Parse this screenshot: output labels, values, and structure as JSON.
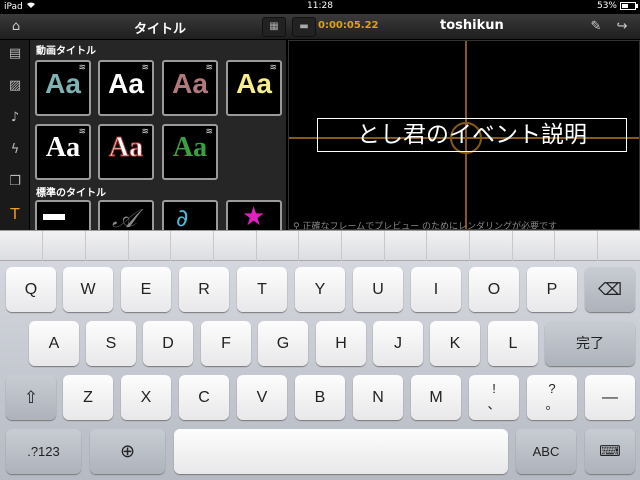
{
  "status": {
    "device": "iPad",
    "time": "11:28",
    "battery": "53%",
    "battery_fraction": 0.53
  },
  "toolbar": {
    "title": "タイトル",
    "timecode": "0:00:05.22",
    "project_name": "toshikun",
    "icons": {
      "home": "home-icon",
      "grid": "grid-icon",
      "film": "film-icon",
      "edit": "edit-icon",
      "share": "share-icon"
    }
  },
  "rail": {
    "icons": [
      "film-strip-icon",
      "photo-icon",
      "music-note-icon",
      "lightning-icon",
      "layers-icon",
      "text-icon"
    ]
  },
  "panel": {
    "section_motion": "動画タイトル",
    "section_standard": "標準のタイトル",
    "motion_titles": [
      {
        "label": "Aa",
        "color": "#7fb2b2"
      },
      {
        "label": "Aa",
        "color": "#ffffff"
      },
      {
        "label": "Aa",
        "color": "#b07a7a"
      },
      {
        "label": "Aa",
        "color": "#f5ee8a"
      },
      {
        "label": "Aa",
        "color": "#ffffff"
      },
      {
        "label": "Aa",
        "color": "#ffffff"
      },
      {
        "label": "Aa",
        "color": "#3aa040"
      }
    ]
  },
  "preview": {
    "title_text": "とし君のイベント説明",
    "note": "正確なフレームでプレビュー のためにレンダリングが必要です"
  },
  "keyboard": {
    "row1": [
      "Q",
      "W",
      "E",
      "R",
      "T",
      "Y",
      "U",
      "I",
      "O",
      "P"
    ],
    "row2": [
      "A",
      "S",
      "D",
      "F",
      "G",
      "H",
      "J",
      "K",
      "L"
    ],
    "row3": [
      "Z",
      "X",
      "C",
      "V",
      "B",
      "N",
      "M"
    ],
    "done": "完了",
    "excl_top": "!",
    "excl_bottom": "、",
    "q_top": "?",
    "q_bottom": "。",
    "dash": "—",
    "numbers": ".?123",
    "abc": "ABC",
    "icons": {
      "backspace": "backspace-icon",
      "shift": "shift-icon",
      "globe": "globe-icon",
      "dismiss": "keyboard-dismiss-icon"
    }
  }
}
